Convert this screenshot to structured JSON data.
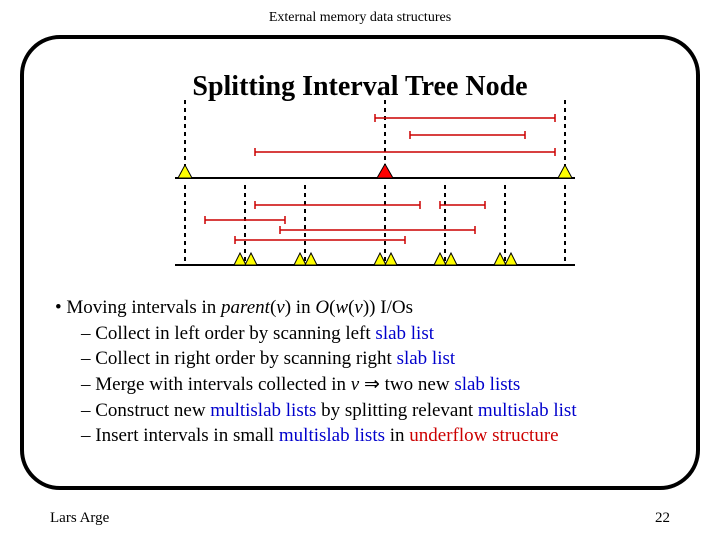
{
  "header": "External memory data structures",
  "title": "Splitting Interval Tree Node",
  "bullet": {
    "main_a": "Moving intervals in ",
    "main_b": "parent",
    "main_c": "(",
    "main_d": "v",
    "main_e": ") in ",
    "main_f": "O",
    "main_g": "(",
    "main_h": "w",
    "main_i": "(",
    "main_j": "v",
    "main_k": ")) I/Os",
    "s1a": "Collect in left order by scanning left ",
    "s1b": "slab list",
    "s2a": "Collect in right order by scanning right ",
    "s2b": "slab list",
    "s3a": "Merge with intervals collected in ",
    "s3b": "v",
    "s3c": " ",
    "s3d": "⇒",
    "s3e": " two new ",
    "s3f": "slab lists",
    "s4a": "Construct new ",
    "s4b": "multislab lists",
    "s4c": " by splitting relevant ",
    "s4d": "multislab list",
    "s5a": "Insert intervals in small ",
    "s5b": "multislab lists",
    "s5c": " in ",
    "s5d": "underflow structure"
  },
  "footer": {
    "author": "Lars Arge",
    "page": "22"
  }
}
